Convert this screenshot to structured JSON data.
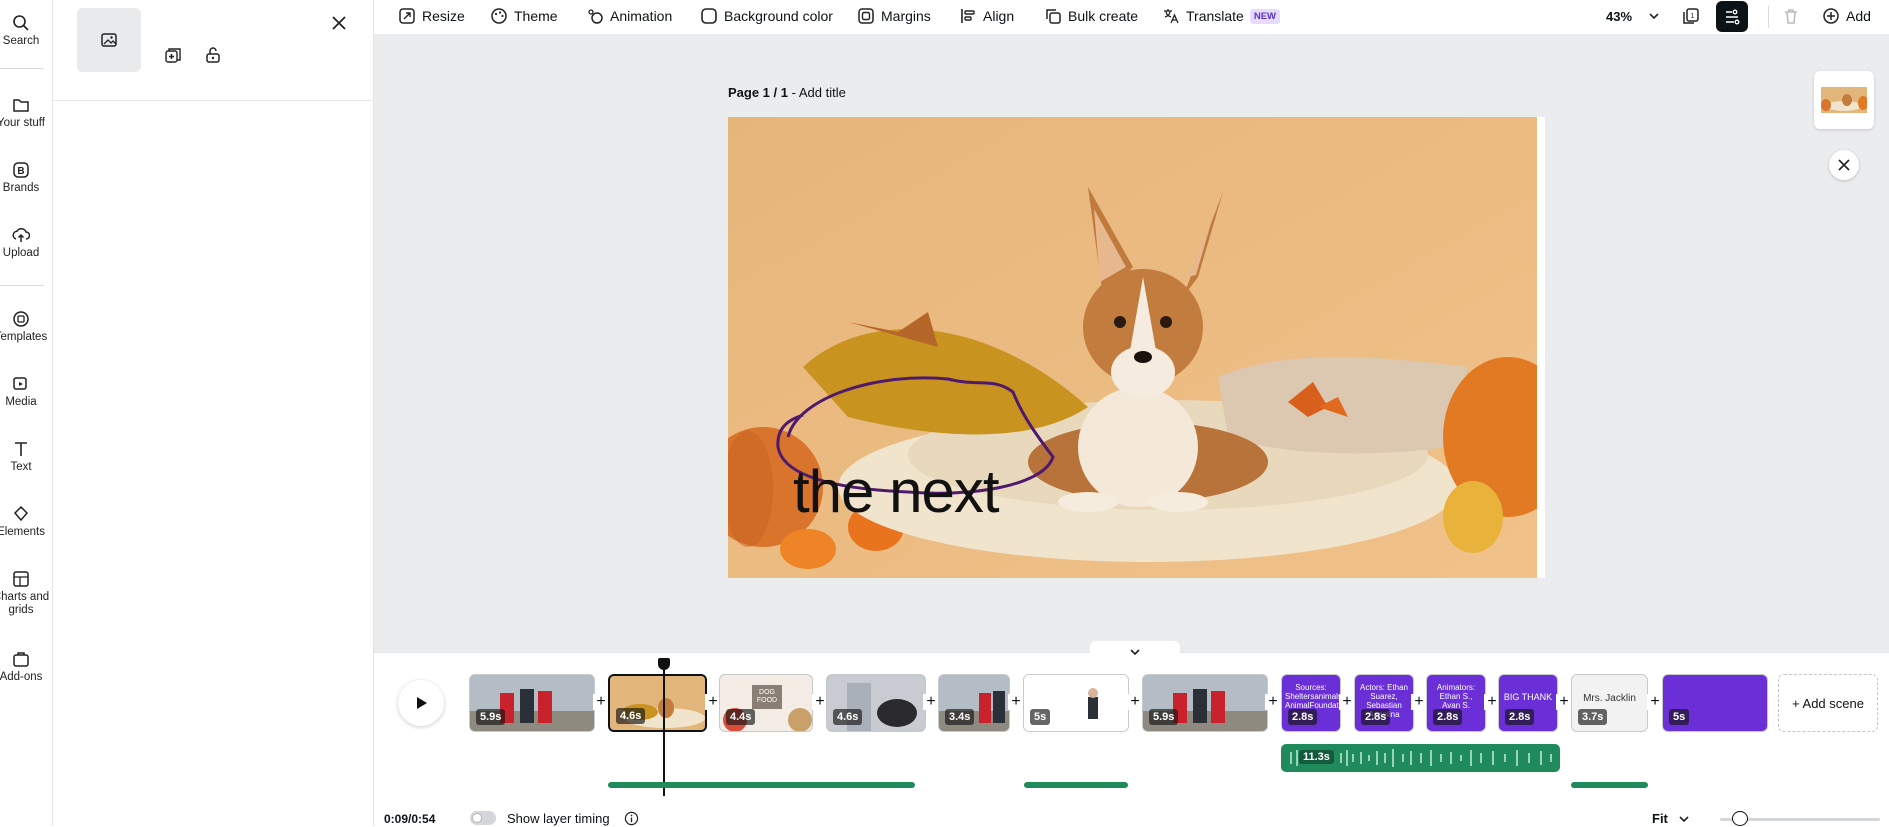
{
  "rail": {
    "items": [
      {
        "label": "Search",
        "icon": "search-icon"
      },
      {
        "label": "Your stuff",
        "icon": "folder-icon"
      },
      {
        "label": "Brands",
        "icon": "brand-icon"
      },
      {
        "label": "Upload",
        "icon": "upload-icon"
      },
      {
        "label": "Templates",
        "icon": "templates-icon"
      },
      {
        "label": "Media",
        "icon": "media-icon"
      },
      {
        "label": "Text",
        "icon": "text-icon"
      },
      {
        "label": "Elements",
        "icon": "elements-icon"
      },
      {
        "label": "Charts and grids",
        "icon": "charts-icon"
      },
      {
        "label": "Add-ons",
        "icon": "addons-icon"
      }
    ]
  },
  "toolbar": {
    "resize": "Resize",
    "theme": "Theme",
    "animation": "Animation",
    "background_color": "Background color",
    "margins": "Margins",
    "align": "Align",
    "bulk_create": "Bulk create",
    "translate": "Translate",
    "translate_badge": "NEW",
    "zoom": "43%",
    "add": "Add"
  },
  "page": {
    "label": "Page 1 / 1",
    "title_placeholder": "Add title",
    "canvas_text": "the next"
  },
  "timeline": {
    "clips": [
      {
        "duration": "5.9s",
        "selected": false
      },
      {
        "duration": "4.6s",
        "selected": true
      },
      {
        "duration": "4.4s",
        "selected": false,
        "caption": "DOG FOOD"
      },
      {
        "duration": "4.6s",
        "selected": false
      },
      {
        "duration": "3.4s",
        "selected": false
      },
      {
        "duration": "5s",
        "selected": false
      },
      {
        "duration": "5.9s",
        "selected": false
      },
      {
        "duration": "2.8s",
        "selected": false,
        "caption": "Sources: Sheltersanimalscount, AnimalFoundation"
      },
      {
        "duration": "2.8s",
        "selected": false,
        "caption": "Actors: Ethan Suarez, Sebastian Angelina"
      },
      {
        "duration": "2.8s",
        "selected": false,
        "caption": "Animators: Ethan S., Avan S."
      },
      {
        "duration": "2.8s",
        "selected": false,
        "caption": "BIG THANK"
      },
      {
        "duration": "3.7s",
        "selected": false,
        "caption": "Mrs. Jacklin"
      },
      {
        "duration": "5s",
        "selected": false
      }
    ],
    "add_scene": "+ Add scene",
    "audio_duration": "11.3s",
    "time": "0:09/0:54",
    "show_layer_timing": "Show layer timing",
    "fit": "Fit"
  },
  "colors": {
    "accent_purple": "#6a2fd6",
    "audio_green": "#1f8a5c",
    "canvas_bg": "#e2b67a"
  }
}
